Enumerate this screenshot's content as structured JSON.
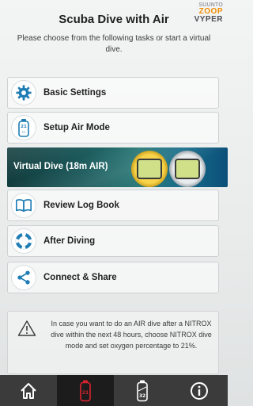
{
  "brand": {
    "line1": "SUUNTO",
    "line2": "ZOOP",
    "line3": "VYPER"
  },
  "header": {
    "title": "Scuba Dive with Air",
    "subtitle": "Please choose from the following tasks or start a virtual dive."
  },
  "menu": {
    "basic_settings": "Basic Settings",
    "setup_air_mode": "Setup Air Mode",
    "virtual_dive": "Virtual Dive (18m AIR)",
    "review_log_book": "Review Log Book",
    "after_diving": "After Diving",
    "connect_share": "Connect & Share"
  },
  "notice": {
    "text": "In case you want to do an AIR dive after a NITROX dive within the next 48 hours, choose NITROX dive mode and set oxygen percentage to 21%."
  },
  "tabbar": {
    "air_tank_number": "21",
    "nitrox_tank_number": "32"
  },
  "colors": {
    "active_tab_red": "#d9232e",
    "icon_blue": "#1f7db5",
    "tabbar_bg": "#3b3b3b"
  }
}
